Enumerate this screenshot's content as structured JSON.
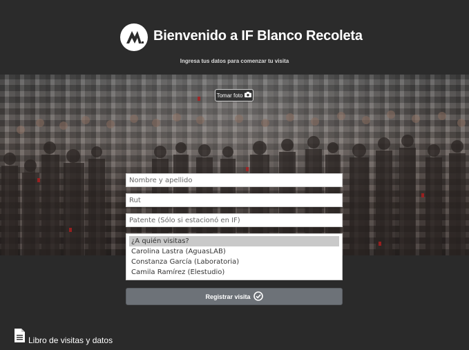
{
  "header": {
    "logo_icon": "mountain-m-logo-icon",
    "title": "Bienvenido a IF Blanco Recoleta",
    "subtitle": "Ingresa tus datos para comenzar tu visita"
  },
  "photo": {
    "take_photo_label": "Tomar foto",
    "camera_icon": "camera-icon"
  },
  "form": {
    "name_placeholder": "Nombre y apellido",
    "rut_placeholder": "Rut",
    "plate_placeholder": "Patente (Sólo si estacionó en IF)",
    "visit_options": [
      "¿A quién visitas?",
      "Carolina Lastra (AguasLAB)",
      "Constanza García (Laboratoria)",
      "Camila Ramírez (Elestudio)"
    ],
    "submit_label": "Registrar visita",
    "submit_icon": "check-circle-icon"
  },
  "footer": {
    "link_label": "Libro de visitas y datos",
    "link_icon": "document-icon"
  },
  "colors": {
    "background": "#2a2a2a",
    "button": "#6d7278",
    "selected_option": "#c9c9c9"
  }
}
